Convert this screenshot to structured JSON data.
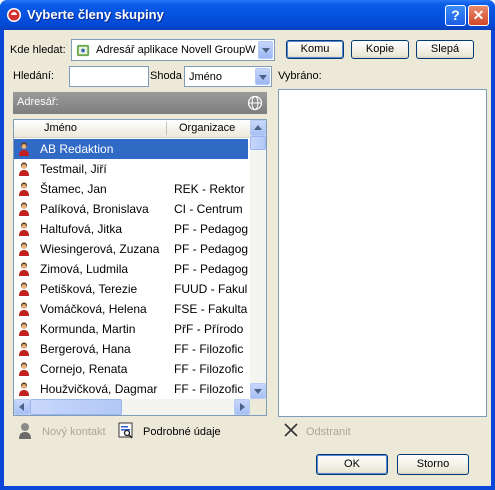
{
  "window": {
    "title": "Vyberte členy skupiny"
  },
  "titlebar": {
    "help_label": "?",
    "close_label": "✕"
  },
  "search_location": {
    "label": "Kde hledat:",
    "value": "Adresář aplikace Novell GroupWi"
  },
  "recipient_buttons": {
    "to": "Komu",
    "cc": "Kopie",
    "bc": "Slepá"
  },
  "search": {
    "label": "Hledání:",
    "value": "",
    "match_label": "Shoda",
    "match_value": "Jméno"
  },
  "selected": {
    "label": "Vybráno:"
  },
  "address_book": {
    "label": "Adresář:"
  },
  "columns": {
    "name": "Jméno",
    "org": "Organizace"
  },
  "rows": [
    {
      "name": "AB Redaktion",
      "org": "",
      "selected": true
    },
    {
      "name": "Testmail, Jiří",
      "org": ""
    },
    {
      "name": "Štamec, Jan",
      "org": "REK - Rektor"
    },
    {
      "name": "Palíková, Bronislava",
      "org": "CI - Centrum"
    },
    {
      "name": "Haltufová, Jitka",
      "org": "PF - Pedagog"
    },
    {
      "name": "Wiesingerová, Zuzana",
      "org": "PF - Pedagog"
    },
    {
      "name": "Zimová, Ludmila",
      "org": "PF - Pedagog"
    },
    {
      "name": "Petišková, Terezie",
      "org": "FUUD - Fakul"
    },
    {
      "name": "Vomáčková, Helena",
      "org": "FSE - Fakulta"
    },
    {
      "name": "Kormunda, Martin",
      "org": "PřF - Přírodo"
    },
    {
      "name": "Bergerová, Hana",
      "org": "FF - Filozofic"
    },
    {
      "name": "Cornejo, Renata",
      "org": "FF - Filozofic"
    },
    {
      "name": "Houžvičková, Dagmar",
      "org": "FF - Filozofic"
    }
  ],
  "actions": {
    "new_contact": "Nový kontakt",
    "details": "Podrobné údaje",
    "remove": "Odstranit"
  },
  "dialog_buttons": {
    "ok": "OK",
    "cancel": "Storno"
  },
  "colors": {
    "titlebar": "#0552e0",
    "selection": "#316ac5",
    "face": "#ece9d8"
  }
}
